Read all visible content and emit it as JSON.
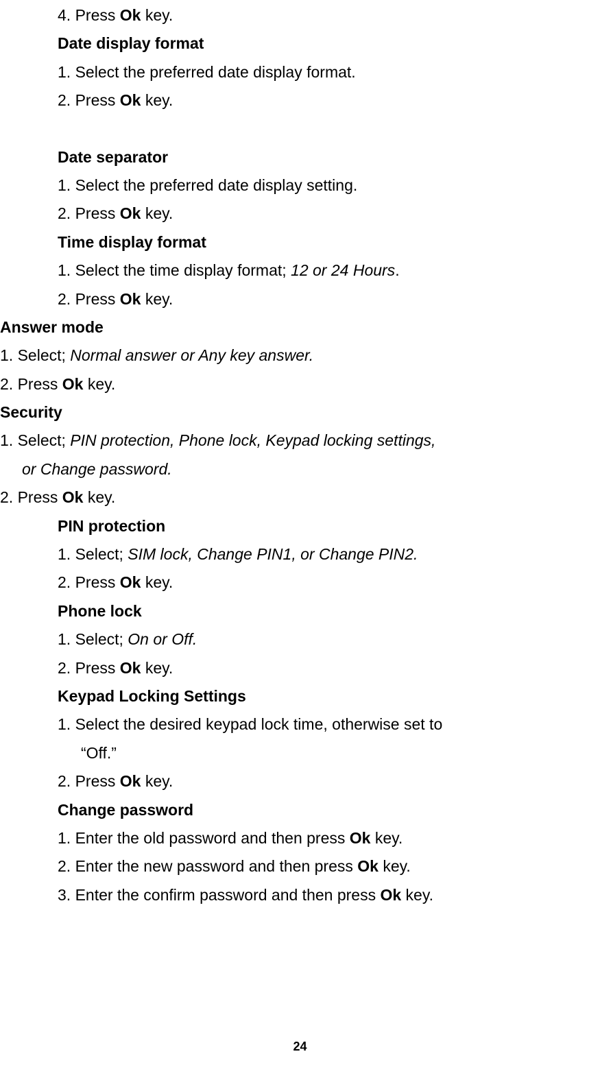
{
  "lines": [
    {
      "class": "indent-1",
      "segments": [
        {
          "text": "4. Press "
        },
        {
          "text": "Ok",
          "bold": true
        },
        {
          "text": " key."
        }
      ]
    },
    {
      "class": "heading",
      "segments": [
        {
          "text": "Date display format",
          "bold": true
        }
      ]
    },
    {
      "class": "indent-1",
      "segments": [
        {
          "text": "1. Select the preferred date display format."
        }
      ]
    },
    {
      "class": "indent-1",
      "segments": [
        {
          "text": "2. Press "
        },
        {
          "text": "Ok",
          "bold": true
        },
        {
          "text": " key."
        }
      ]
    },
    {
      "class": "spacer"
    },
    {
      "class": "heading",
      "segments": [
        {
          "text": "Date separator",
          "bold": true
        }
      ]
    },
    {
      "class": "indent-1",
      "segments": [
        {
          "text": "1. Select the preferred date display setting."
        }
      ]
    },
    {
      "class": "indent-1",
      "segments": [
        {
          "text": "2. Press "
        },
        {
          "text": "Ok",
          "bold": true
        },
        {
          "text": " key."
        }
      ]
    },
    {
      "class": "heading",
      "segments": [
        {
          "text": "Time display format",
          "bold": true
        }
      ]
    },
    {
      "class": "indent-1",
      "segments": [
        {
          "text": "1. Select the time display format; "
        },
        {
          "text": "12 or 24 Hours",
          "italic": true
        },
        {
          "text": "."
        }
      ]
    },
    {
      "class": "indent-1",
      "segments": [
        {
          "text": "2. Press "
        },
        {
          "text": "Ok",
          "bold": true
        },
        {
          "text": " key."
        }
      ]
    },
    {
      "class": "heading-0",
      "segments": [
        {
          "text": "Answer mode",
          "bold": true
        }
      ]
    },
    {
      "class": "indent-0",
      "segments": [
        {
          "text": "1. Select; "
        },
        {
          "text": "Normal answer or Any key answer.",
          "italic": true
        }
      ]
    },
    {
      "class": "indent-0",
      "segments": [
        {
          "text": "2. Press "
        },
        {
          "text": "Ok",
          "bold": true
        },
        {
          "text": " key."
        }
      ]
    },
    {
      "class": "heading-0",
      "segments": [
        {
          "text": "Security",
          "bold": true
        }
      ]
    },
    {
      "class": "indent-0",
      "segments": [
        {
          "text": "1. Select; "
        },
        {
          "text": "PIN protection, Phone lock, Keypad locking settings,",
          "italic": true
        }
      ]
    },
    {
      "class": "step-indent-0",
      "segments": [
        {
          "text": "or Change password.",
          "italic": true
        }
      ]
    },
    {
      "class": "indent-0",
      "segments": [
        {
          "text": "2. Press "
        },
        {
          "text": "Ok",
          "bold": true
        },
        {
          "text": " key."
        }
      ]
    },
    {
      "class": "heading",
      "segments": [
        {
          "text": "PIN protection",
          "bold": true
        }
      ]
    },
    {
      "class": "indent-1",
      "segments": [
        {
          "text": "1. Select; "
        },
        {
          "text": "SIM lock, Change PIN1, or Change PIN2.",
          "italic": true
        }
      ]
    },
    {
      "class": "indent-1",
      "segments": [
        {
          "text": "2. Press "
        },
        {
          "text": "Ok",
          "bold": true
        },
        {
          "text": " key."
        }
      ]
    },
    {
      "class": "heading",
      "segments": [
        {
          "text": "Phone lock",
          "bold": true
        }
      ]
    },
    {
      "class": "indent-1",
      "segments": [
        {
          "text": "1. Select; "
        },
        {
          "text": "On or Off.",
          "italic": true
        }
      ]
    },
    {
      "class": "indent-1",
      "segments": [
        {
          "text": "2. Press "
        },
        {
          "text": "Ok",
          "bold": true
        },
        {
          "text": " key."
        }
      ]
    },
    {
      "class": "heading",
      "segments": [
        {
          "text": "Keypad Locking Settings",
          "bold": true
        }
      ]
    },
    {
      "class": "indent-1",
      "segments": [
        {
          "text": "1. Select the desired keypad lock time, otherwise set to"
        }
      ]
    },
    {
      "class": "step-indent-1",
      "segments": [
        {
          "text": "“Off.”"
        }
      ]
    },
    {
      "class": "indent-1",
      "segments": [
        {
          "text": "2. Press "
        },
        {
          "text": "Ok",
          "bold": true
        },
        {
          "text": " key."
        }
      ]
    },
    {
      "class": "heading",
      "segments": [
        {
          "text": "Change password",
          "bold": true
        }
      ]
    },
    {
      "class": "indent-1",
      "segments": [
        {
          "text": "1. Enter the old password and then press "
        },
        {
          "text": "Ok",
          "bold": true
        },
        {
          "text": " key."
        }
      ]
    },
    {
      "class": "indent-1",
      "segments": [
        {
          "text": "2. Enter the new password and then press "
        },
        {
          "text": "Ok",
          "bold": true
        },
        {
          "text": " key."
        }
      ]
    },
    {
      "class": "indent-1",
      "segments": [
        {
          "text": "3. Enter the confirm password and then press "
        },
        {
          "text": "Ok",
          "bold": true
        },
        {
          "text": " key."
        }
      ]
    }
  ],
  "pageNumber": "24"
}
